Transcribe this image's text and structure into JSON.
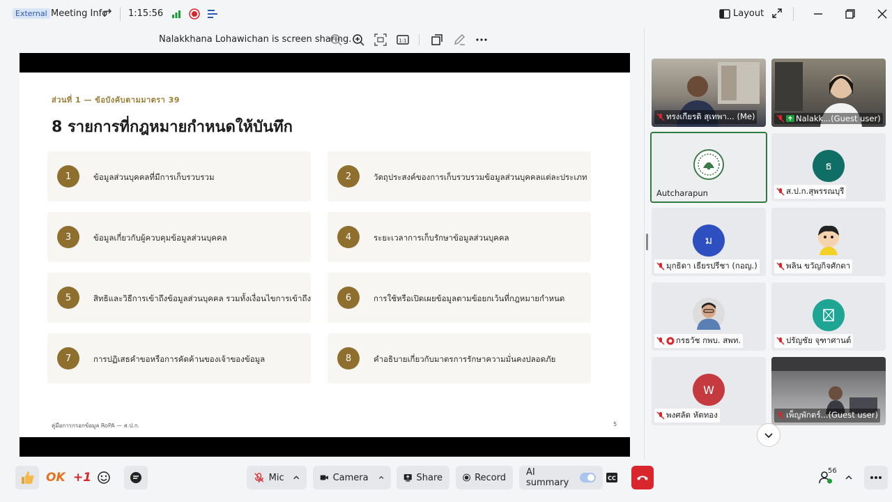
{
  "titlebar": {
    "external_badge": "External",
    "meeting_info": "Meeting Info",
    "timer": "1:15:56",
    "layout_label": "Layout"
  },
  "sharebar": {
    "sharing_text": "Nalakkhana Lohawichan is screen sharing."
  },
  "slide": {
    "kicker": "ส่วนที่ 1 — ข้อบังคับตามมาตรา 39",
    "title": "8 รายการที่กฎหมายกำหนดให้บันทึก",
    "items": [
      {
        "num": "1",
        "text": "ข้อมูลส่วนบุคคลที่มีการเก็บรวบรวม"
      },
      {
        "num": "2",
        "text": "วัตถุประสงค์ของการเก็บรวบรวมข้อมูลส่วนบุคคลแต่ละประเภท"
      },
      {
        "num": "3",
        "text": "ข้อมูลเกี่ยวกับผู้ควบคุมข้อมูลส่วนบุคคล"
      },
      {
        "num": "4",
        "text": "ระยะเวลาการเก็บรักษาข้อมูลส่วนบุคคล"
      },
      {
        "num": "5",
        "text": "สิทธิและวิธีการเข้าถึงข้อมูลส่วนบุคคล รวมทั้งเงื่อนไขการเข้าถึง"
      },
      {
        "num": "6",
        "text": "การใช้หรือเปิดเผยข้อมูลตามข้อยกเว้นที่กฎหมายกำหนด"
      },
      {
        "num": "7",
        "text": "การปฏิเสธคำขอหรือการคัดค้านของเจ้าของข้อมูล"
      },
      {
        "num": "8",
        "text": "คำอธิบายเกี่ยวกับมาตรการรักษาความมั่นคงปลอดภัย"
      }
    ],
    "footer": "คู่มือการกรอกข้อมูล RoPA — ส.ป.ก.",
    "page_number": "5"
  },
  "participants": [
    {
      "name": "ทรงเกียรติ สุเทพา... (Me)",
      "initial": "",
      "color": ""
    },
    {
      "name": "Nalakk...(Guest user)",
      "initial": "",
      "color": ""
    },
    {
      "name": "Autcharapun",
      "initial": "",
      "color": ""
    },
    {
      "name": "ส.ป.ก.สุพรรณบุรี",
      "initial": "ธ",
      "color": "#0f6e66"
    },
    {
      "name": "มุกธิดา เธียรปรีชา (กอญ.)",
      "initial": "ม",
      "color": "#2e4fbf"
    },
    {
      "name": "พลิน ขวัญกิจศักดา",
      "initial": "",
      "color": ""
    },
    {
      "name": "กรธวัช กพบ. สพท.",
      "initial": "",
      "color": ""
    },
    {
      "name": "ปรัญชัย จุฑาศานต์",
      "initial": "",
      "color": "#1fa593"
    },
    {
      "name": "พงศลัด หัตทอง",
      "initial": "W",
      "color": "#c53a3f"
    },
    {
      "name": "เพ็ญพักตร์...(Guest user)",
      "initial": "",
      "color": ""
    }
  ],
  "bottombar": {
    "ok_label": "OK",
    "plus_one_label": "+1",
    "mic_label": "Mic",
    "camera_label": "Camera",
    "share_label": "Share",
    "record_label": "Record",
    "ai_summary_label": "AI summary",
    "participant_count": "56"
  }
}
